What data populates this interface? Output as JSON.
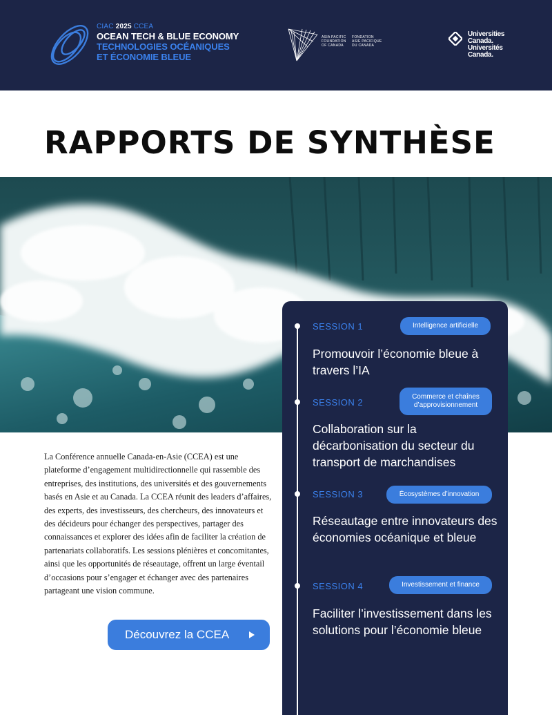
{
  "header": {
    "ciac_kicker_a": "CIAC",
    "ciac_kicker_year": "2025",
    "ciac_kicker_b": "CCEA",
    "ciac_title_en": "OCEAN TECH & BLUE ECONOMY",
    "ciac_title_fr_1": "TECHNOLOGIES OCÉANIQUES",
    "ciac_title_fr_2": "ET ÉCONOMIE BLEUE",
    "apf_en": "ASIA PACIFIC\nFOUNDATION\nOF CANADA",
    "apf_fr": "FONDATION\nASIE PACIFIQUE\nDU CANADA",
    "uc_line1": "Universities",
    "uc_line2": "Canada.",
    "uc_line3": "Universités",
    "uc_line4": "Canada."
  },
  "page_title": "RAPPORTS DE SYNTHÈSE",
  "intro": {
    "paragraph": "La Conférence annuelle Canada-en-Asie (CCEA) est une plateforme d’engagement multidirectionnelle qui rassemble des entreprises, des institutions, des universités et des gouvernements basés en Asie et au Canada. La CCEA réunit des leaders d’affaires, des experts, des investisseurs, des chercheurs, des innovateurs et des décideurs pour échanger des perspectives, partager des connaissances et explorer des idées afin de faciliter la création de partenariats collaboratifs. Les sessions plénières et concomitantes, ainsi que les opportunités de réseautage, offrent un large éventail d’occasions pour s’engager et échanger avec des partenaires partageant une vision commune.",
    "cta_label": "Découvrez la CCEA"
  },
  "sessions": [
    {
      "label": "SESSION 1",
      "tag": "Intelligence artificielle",
      "title": "Promouvoir l’économie bleue à travers l’IA"
    },
    {
      "label": "SESSION 2",
      "tag": "Commerce et chaînes d’approvisionnement",
      "title": "Collaboration sur la décarbonisation du secteur du transport de marchandises"
    },
    {
      "label": "SESSION 3",
      "tag": "Écosystèmes d’innovation",
      "title": "Réseautage entre innovateurs des économies océanique et bleue"
    },
    {
      "label": "SESSION 4",
      "tag": "Investissement et finance",
      "title": "Faciliter l’investissement dans les solutions pour l’économie bleue"
    }
  ],
  "colors": {
    "navy": "#1c2547",
    "accent_blue": "#3b7ddd",
    "label_blue": "#3b82ee"
  },
  "icons": [
    "ciac-rings-logo-icon",
    "apf-lines-logo-icon",
    "universities-canada-diamond-icon",
    "play-arrow-icon"
  ]
}
